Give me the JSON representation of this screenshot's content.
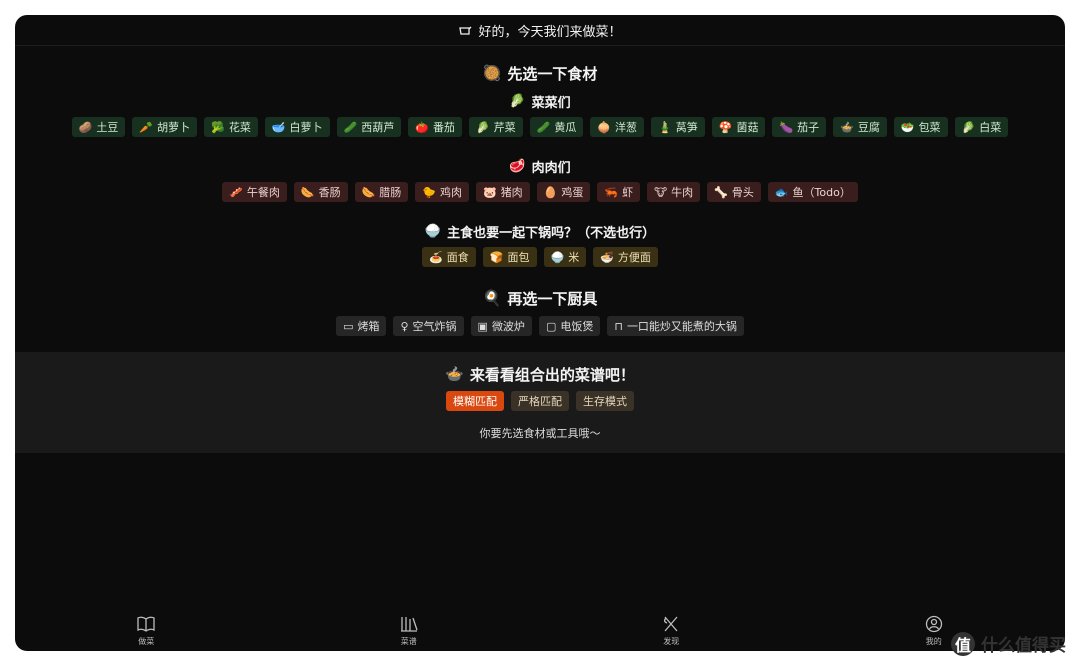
{
  "topbar": {
    "icon": "pot-icon",
    "title": "好的，今天我们来做菜！"
  },
  "ingredients": {
    "title": "先选一下食材",
    "title_icon": "🥘",
    "vegetables": {
      "title": "菜菜们",
      "icon": "🥬",
      "items": [
        {
          "emoji": "🥔",
          "label": "土豆"
        },
        {
          "emoji": "🥕",
          "label": "胡萝卜"
        },
        {
          "emoji": "🥦",
          "label": "花菜"
        },
        {
          "emoji": "🥣",
          "label": "白萝卜"
        },
        {
          "emoji": "🥒",
          "label": "西葫芦"
        },
        {
          "emoji": "🍅",
          "label": "番茄"
        },
        {
          "emoji": "🥬",
          "label": "芹菜"
        },
        {
          "emoji": "🥒",
          "label": "黄瓜"
        },
        {
          "emoji": "🧅",
          "label": "洋葱"
        },
        {
          "emoji": "🎍",
          "label": "莴笋"
        },
        {
          "emoji": "🍄",
          "label": "菌菇"
        },
        {
          "emoji": "🍆",
          "label": "茄子"
        },
        {
          "emoji": "🍲",
          "label": "豆腐"
        },
        {
          "emoji": "🥗",
          "label": "包菜"
        },
        {
          "emoji": "🥬",
          "label": "白菜"
        }
      ]
    },
    "meats": {
      "title": "肉肉们",
      "icon": "🥩",
      "items": [
        {
          "emoji": "🥓",
          "label": "午餐肉"
        },
        {
          "emoji": "🌭",
          "label": "香肠"
        },
        {
          "emoji": "🌭",
          "label": "腊肠"
        },
        {
          "emoji": "🐤",
          "label": "鸡肉"
        },
        {
          "emoji": "🐷",
          "label": "猪肉"
        },
        {
          "emoji": "🥚",
          "label": "鸡蛋"
        },
        {
          "emoji": "🦐",
          "label": "虾"
        },
        {
          "emoji": "🐮",
          "label": "牛肉"
        },
        {
          "emoji": "🦴",
          "label": "骨头"
        },
        {
          "emoji": "🐟",
          "label": "鱼（Todo）"
        }
      ]
    },
    "staples": {
      "title": "主食也要一起下锅吗？（不选也行）",
      "icon": "🍚",
      "items": [
        {
          "emoji": "🍝",
          "label": "面食"
        },
        {
          "emoji": "🍞",
          "label": "面包"
        },
        {
          "emoji": "🍚",
          "label": "米"
        },
        {
          "emoji": "🍜",
          "label": "方便面"
        }
      ]
    }
  },
  "tools": {
    "title": "再选一下厨具",
    "icon": "🍳",
    "items": [
      {
        "emoji": "▭",
        "label": "烤箱"
      },
      {
        "emoji": "♀",
        "label": "空气炸锅"
      },
      {
        "emoji": "▣",
        "label": "微波炉"
      },
      {
        "emoji": "▢",
        "label": "电饭煲"
      },
      {
        "emoji": "⊓",
        "label": "一口能炒又能煮的大锅"
      }
    ]
  },
  "result": {
    "title": "来看看组合出的菜谱吧！",
    "icon": "🍲",
    "modes": [
      {
        "label": "模糊匹配",
        "active": true
      },
      {
        "label": "严格匹配",
        "active": false
      },
      {
        "label": "生存模式",
        "active": false
      }
    ],
    "hint": "你要先选食材或工具哦～"
  },
  "bottom_nav": [
    {
      "label": "做菜",
      "icon": "book-icon"
    },
    {
      "label": "菜谱",
      "icon": "library-icon"
    },
    {
      "label": "发现",
      "icon": "utensils-icon"
    },
    {
      "label": "我的",
      "icon": "user-icon"
    }
  ],
  "watermark": {
    "symbol": "值",
    "text": "什么值得买"
  }
}
